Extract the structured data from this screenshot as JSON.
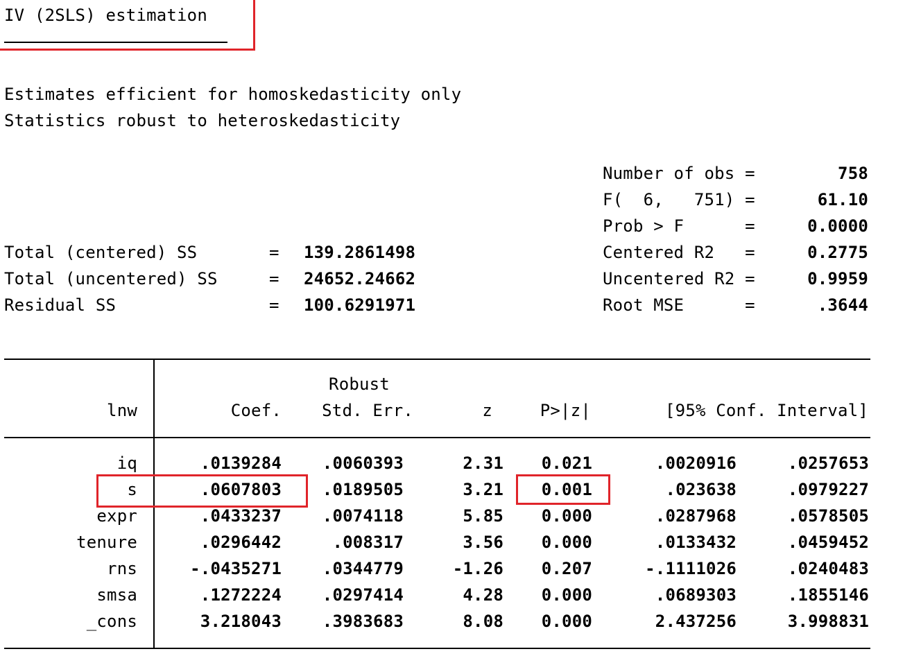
{
  "title": "IV (2SLS) estimation",
  "notes": [
    "Estimates efficient for homoskedasticity only",
    "Statistics robust to heteroskedasticity"
  ],
  "left_stats": [
    {
      "label": "Total (centered) SS",
      "eq": "=",
      "value": "139.2861498"
    },
    {
      "label": "Total (uncentered) SS",
      "eq": "=",
      "value": "24652.24662"
    },
    {
      "label": "Residual SS",
      "eq": "=",
      "value": "100.6291971"
    }
  ],
  "right_stats": [
    {
      "label": "Number of obs =",
      "value": "758"
    },
    {
      "label": "F(  6,   751) =",
      "value": "61.10"
    },
    {
      "label": "Prob > F      =",
      "value": "0.0000"
    },
    {
      "label": "Centered R2   =",
      "value": "0.2775"
    },
    {
      "label": "Uncentered R2 =",
      "value": "0.9959"
    },
    {
      "label": "Root MSE      =",
      "value": ".3644"
    }
  ],
  "table": {
    "header_top": "Robust",
    "headers": [
      "lnw",
      "Coef.",
      "Std. Err.",
      "z",
      "P>|z|",
      "[95% Conf. Interval]"
    ],
    "rows": [
      {
        "var": "iq",
        "coef": ".0139284",
        "se": ".0060393",
        "z": "2.31",
        "p": "0.021",
        "lo": ".0020916",
        "hi": ".0257653"
      },
      {
        "var": "s",
        "coef": ".0607803",
        "se": ".0189505",
        "z": "3.21",
        "p": "0.001",
        "lo": ".023638",
        "hi": ".0979227"
      },
      {
        "var": "expr",
        "coef": ".0433237",
        "se": ".0074118",
        "z": "5.85",
        "p": "0.000",
        "lo": ".0287968",
        "hi": ".0578505"
      },
      {
        "var": "tenure",
        "coef": ".0296442",
        "se": ".008317",
        "z": "3.56",
        "p": "0.000",
        "lo": ".0133432",
        "hi": ".0459452"
      },
      {
        "var": "rns",
        "coef": "-.0435271",
        "se": ".0344779",
        "z": "-1.26",
        "p": "0.207",
        "lo": "-.1111026",
        "hi": ".0240483"
      },
      {
        "var": "smsa",
        "coef": ".1272224",
        "se": ".0297414",
        "z": "4.28",
        "p": "0.000",
        "lo": ".0689303",
        "hi": ".1855146"
      },
      {
        "var": "_cons",
        "coef": "3.218043",
        "se": ".3983683",
        "z": "8.08",
        "p": "0.000",
        "lo": "2.437256",
        "hi": "3.998831"
      }
    ]
  },
  "highlight_color": "#e0242a"
}
